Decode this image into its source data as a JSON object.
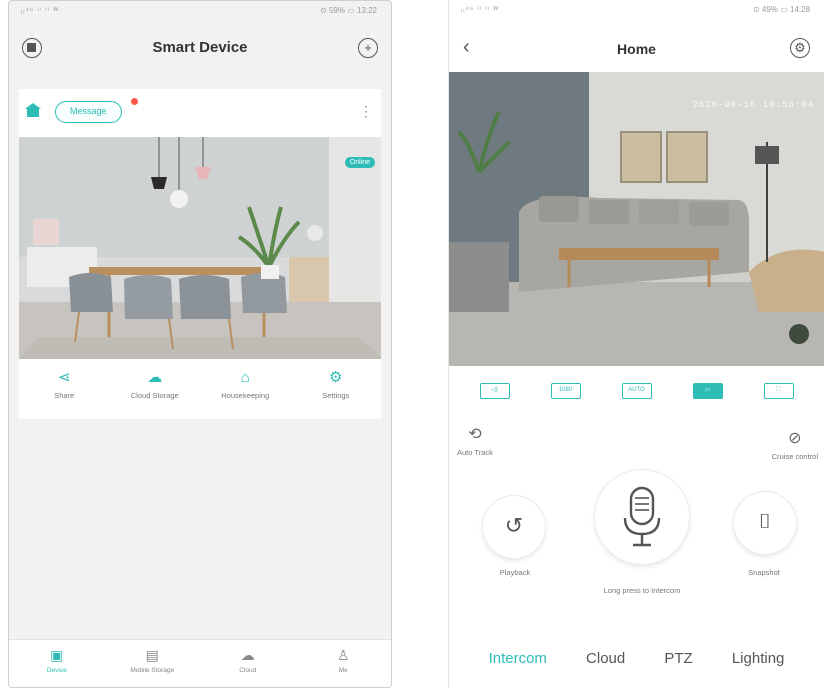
{
  "left": {
    "status_left": "ᵢᵢ⁴⁶ ˡⁱ ˡⁱ ᵂ",
    "status_right": "⊙ 59% ▭ 13:22",
    "title": "Smart Device",
    "device_name": "Message",
    "live_badge": "Online",
    "actions": [
      {
        "icon": "share-icon",
        "glyph": "⋖",
        "label": "Share"
      },
      {
        "icon": "cloud-icon",
        "glyph": "☁",
        "label": "Cloud Storage"
      },
      {
        "icon": "house-icon",
        "glyph": "⌂",
        "label": "Housekeeping"
      },
      {
        "icon": "gear-icon",
        "glyph": "⚙",
        "label": "Settings"
      }
    ],
    "tabs": [
      {
        "icon": "device-icon",
        "glyph": "▣",
        "label": "Device",
        "active": true
      },
      {
        "icon": "storage-icon",
        "glyph": "▤",
        "label": "Mobile Storage",
        "active": false
      },
      {
        "icon": "cloud-icon",
        "glyph": "☁",
        "label": "Cloud",
        "active": false
      },
      {
        "icon": "person-icon",
        "glyph": "♙",
        "label": "Me",
        "active": false
      }
    ]
  },
  "right": {
    "status_left": "ᵢᵢ⁴⁶ ˡⁱ ˡⁱ ᵂ",
    "status_right": "⊙ 49% ▭ 14:28",
    "title": "Home",
    "timestamp": "2020-08-16 10:58:04",
    "controls": [
      {
        "name": "sound-toggle",
        "label": "◁)",
        "active": false
      },
      {
        "name": "quality-toggle",
        "label": "1080",
        "active": false
      },
      {
        "name": "auto-toggle",
        "label": "AUTO",
        "active": false
      },
      {
        "name": "ptz-toggle",
        "label": "▭",
        "active": true
      },
      {
        "name": "fullscreen-toggle",
        "label": "⛶",
        "active": false
      }
    ],
    "auto_track": "Auto Track",
    "cruise_control": "Cruise control",
    "playback": "Playback",
    "snapshot": "Snapshot",
    "intercom_hint": "Long press to Intercom",
    "func_tabs": [
      {
        "label": "Intercom",
        "active": true
      },
      {
        "label": "Cloud",
        "active": false
      },
      {
        "label": "PTZ",
        "active": false
      },
      {
        "label": "Lighting",
        "active": false
      }
    ]
  },
  "colors": {
    "accent": "#2dbdb6",
    "badge_dot": "#ff5a4a"
  }
}
